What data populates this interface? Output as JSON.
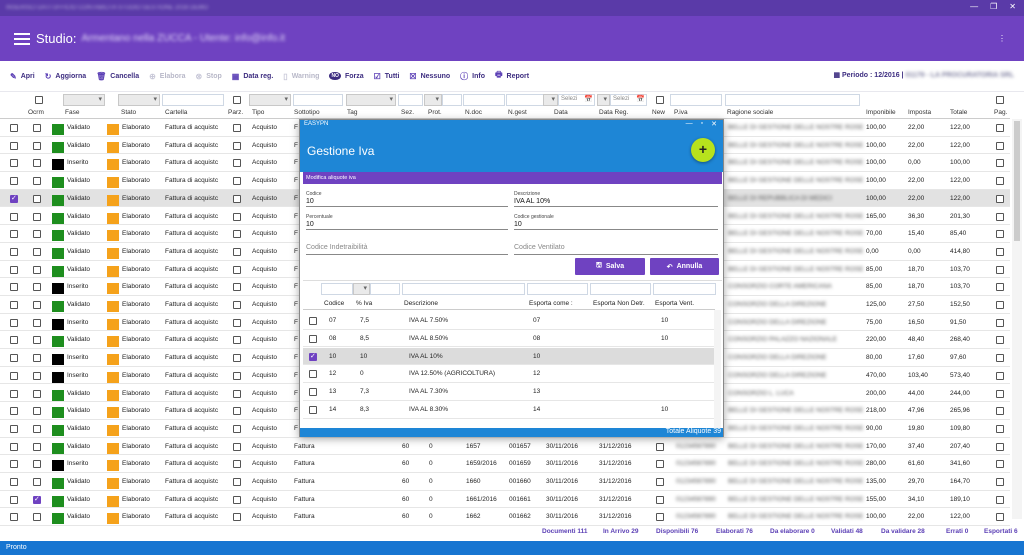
{
  "titlebar": {
    "text": "INSERISCI DATI UFFICIO CONTABILITA STUDIO GESTIONE 2016 DEMO",
    "btns": [
      "—",
      "❐",
      "✕"
    ]
  },
  "header": {
    "title": "Studio:",
    "subtitle": "Armentano nella ZUCCA - Utente: info@info.it",
    "menu_dots": "⋮"
  },
  "toolbar": {
    "items": [
      {
        "label": "Apri",
        "icon": "✎",
        "icon_name": "edit-icon",
        "disabled": false
      },
      {
        "label": "Aggiorna",
        "icon": "↻",
        "icon_name": "refresh-icon",
        "disabled": false
      },
      {
        "label": "Cancella",
        "icon": "🗑",
        "icon_name": "trash-icon",
        "disabled": false
      },
      {
        "label": "Elabora",
        "icon": "⊕",
        "icon_name": "process-icon",
        "disabled": true
      },
      {
        "label": "Stop",
        "icon": "⊗",
        "icon_name": "stop-icon",
        "disabled": true
      },
      {
        "label": "Data reg.",
        "icon": "▦",
        "icon_name": "calendar-icon",
        "disabled": false
      },
      {
        "label": "Warning",
        "icon": "▯",
        "icon_name": "warning-icon",
        "disabled": true
      },
      {
        "label": "Forza",
        "icon": "NO",
        "icon_name": "force-icon",
        "disabled": false
      },
      {
        "label": "Tutti",
        "icon": "☑",
        "icon_name": "select-all-icon",
        "disabled": false
      },
      {
        "label": "Nessuno",
        "icon": "☒",
        "icon_name": "select-none-icon",
        "disabled": false
      },
      {
        "label": "Info",
        "icon": "ⓘ",
        "icon_name": "info-icon",
        "disabled": false
      },
      {
        "label": "Report",
        "icon": "🖶",
        "icon_name": "report-icon",
        "disabled": false
      }
    ],
    "periodo": "Periodo : 12/2016 |",
    "periodo_extra": "01179 - LA PROCURATORIA SRL",
    "periodo_mid": ": 1179 -"
  },
  "filters": {
    "select_placeholder": "Selezi",
    "date_icon": "📅"
  },
  "columns": [
    "Ocrm",
    "Fase",
    "Stato",
    "Cartella",
    "Parz.",
    "Tipo",
    "Sottotipo",
    "Tag",
    "Sez.",
    "Prot.",
    "N.doc",
    "N.gest",
    "Data",
    "Data Reg.",
    "New",
    "P.iva",
    "Ragione sociale",
    "Imponibile",
    "Imposta",
    "Totale",
    "Pag."
  ],
  "rows": [
    {
      "ocrm": false,
      "fase": "Validato",
      "fc": "g",
      "stato": "Elaborato",
      "cartella": "Fattura di acquistc",
      "tipo": "Acquisto",
      "sott": "F",
      "sez": "",
      "prot": "",
      "ndoc": "",
      "ngest": "",
      "data": "",
      "dreg": "",
      "piva": "",
      "rag": "BELLE DI GESTIONE DELLE NOSTRE ROSE",
      "imp": "100,00",
      "iva": "22,00",
      "tot": "122,00",
      "sel": false,
      "selcb": false
    },
    {
      "ocrm": false,
      "fase": "Validato",
      "fc": "g",
      "stato": "Elaborato",
      "cartella": "Fattura di acquistc",
      "tipo": "Acquisto",
      "sott": "F",
      "sez": "",
      "prot": "",
      "ndoc": "",
      "ngest": "",
      "data": "",
      "dreg": "",
      "piva": "",
      "rag": "BELLE DI GESTIONE DELLE NOSTRE ROSE",
      "imp": "100,00",
      "iva": "22,00",
      "tot": "122,00",
      "sel": false,
      "selcb": false
    },
    {
      "ocrm": false,
      "fase": "Inserito",
      "fc": "b",
      "stato": "Elaborato",
      "cartella": "Fattura di acquistc",
      "tipo": "Acquisto",
      "sott": "F",
      "sez": "",
      "prot": "",
      "ndoc": "",
      "ngest": "",
      "data": "",
      "dreg": "",
      "piva": "",
      "rag": "BELLE DI GESTIONE DELLE NOSTRE ROSE",
      "imp": "100,00",
      "iva": "0,00",
      "tot": "100,00",
      "sel": false,
      "selcb": false
    },
    {
      "ocrm": false,
      "fase": "Validato",
      "fc": "g",
      "stato": "Elaborato",
      "cartella": "Fattura di acquistc",
      "tipo": "Acquisto",
      "sott": "F",
      "sez": "",
      "prot": "",
      "ndoc": "",
      "ngest": "",
      "data": "",
      "dreg": "",
      "piva": "",
      "rag": "BELLE DI GESTIONE DELLE NOSTRE ROSE",
      "imp": "100,00",
      "iva": "22,00",
      "tot": "122,00",
      "sel": false,
      "selcb": false
    },
    {
      "ocrm": false,
      "fase": "Validato",
      "fc": "g",
      "stato": "Elaborato",
      "cartella": "Fattura di acquistc",
      "tipo": "Acquisto",
      "sott": "F",
      "sez": "",
      "prot": "",
      "ndoc": "",
      "ngest": "",
      "data": "",
      "dreg": "",
      "piva": "",
      "rag": "BELLE DI REPUBBLICA DI MEDICI",
      "imp": "100,00",
      "iva": "22,00",
      "tot": "122,00",
      "sel": true,
      "selcb": true
    },
    {
      "ocrm": false,
      "fase": "Validato",
      "fc": "g",
      "stato": "Elaborato",
      "cartella": "Fattura di acquistc",
      "tipo": "Acquisto",
      "sott": "F",
      "sez": "",
      "prot": "",
      "ndoc": "",
      "ngest": "",
      "data": "",
      "dreg": "",
      "piva": "",
      "rag": "BELLE DI GESTIONE DELLE NOSTRE ROSE",
      "imp": "165,00",
      "iva": "36,30",
      "tot": "201,30",
      "sel": false,
      "selcb": false
    },
    {
      "ocrm": false,
      "fase": "Validato",
      "fc": "g",
      "stato": "Elaborato",
      "cartella": "Fattura di acquistc",
      "tipo": "Acquisto",
      "sott": "F",
      "sez": "",
      "prot": "",
      "ndoc": "",
      "ngest": "",
      "data": "",
      "dreg": "",
      "piva": "",
      "rag": "BELLE DI GESTIONE DELLE NOSTRE ROSE",
      "imp": "70,00",
      "iva": "15,40",
      "tot": "85,40",
      "sel": false,
      "selcb": false
    },
    {
      "ocrm": false,
      "fase": "Validato",
      "fc": "g",
      "stato": "Elaborato",
      "cartella": "Fattura di acquistc",
      "tipo": "Acquisto",
      "sott": "F",
      "sez": "",
      "prot": "",
      "ndoc": "",
      "ngest": "",
      "data": "",
      "dreg": "",
      "piva": "",
      "rag": "BELLE DI GESTIONE DELLE NOSTRE ROSE",
      "imp": "0,00",
      "iva": "0,00",
      "tot": "414,80",
      "sel": false,
      "selcb": false
    },
    {
      "ocrm": false,
      "fase": "Validato",
      "fc": "g",
      "stato": "Elaborato",
      "cartella": "Fattura di acquistc",
      "tipo": "Acquisto",
      "sott": "F",
      "sez": "",
      "prot": "",
      "ndoc": "",
      "ngest": "",
      "data": "",
      "dreg": "",
      "piva": "",
      "rag": "BELLE DI GESTIONE DELLE NOSTRE ROSE",
      "imp": "85,00",
      "iva": "18,70",
      "tot": "103,70",
      "sel": false,
      "selcb": false
    },
    {
      "ocrm": false,
      "fase": "Inserito",
      "fc": "b",
      "stato": "Elaborato",
      "cartella": "Fattura di acquistc",
      "tipo": "Acquisto",
      "sott": "F",
      "sez": "",
      "prot": "",
      "ndoc": "",
      "ngest": "",
      "data": "",
      "dreg": "",
      "piva": "",
      "rag": "CONSORZIO CORTE AMERICANA",
      "imp": "85,00",
      "iva": "18,70",
      "tot": "103,70",
      "sel": false,
      "selcb": false
    },
    {
      "ocrm": false,
      "fase": "Validato",
      "fc": "g",
      "stato": "Elaborato",
      "cartella": "Fattura di acquistc",
      "tipo": "Acquisto",
      "sott": "F",
      "sez": "",
      "prot": "",
      "ndoc": "",
      "ngest": "",
      "data": "",
      "dreg": "",
      "piva": "",
      "rag": "CONSORZIO DELLA DIREZIONE",
      "imp": "125,00",
      "iva": "27,50",
      "tot": "152,50",
      "sel": false,
      "selcb": false
    },
    {
      "ocrm": false,
      "fase": "Inserito",
      "fc": "b",
      "stato": "Elaborato",
      "cartella": "Fattura di acquistc",
      "tipo": "Acquisto",
      "sott": "F",
      "sez": "",
      "prot": "",
      "ndoc": "",
      "ngest": "",
      "data": "",
      "dreg": "",
      "piva": "",
      "rag": "CONSORZIO DELLA DIREZIONE",
      "imp": "75,00",
      "iva": "16,50",
      "tot": "91,50",
      "sel": false,
      "selcb": false
    },
    {
      "ocrm": false,
      "fase": "Validato",
      "fc": "g",
      "stato": "Elaborato",
      "cartella": "Fattura di acquistc",
      "tipo": "Acquisto",
      "sott": "F",
      "sez": "",
      "prot": "",
      "ndoc": "",
      "ngest": "",
      "data": "",
      "dreg": "",
      "piva": "",
      "rag": "CONSORZIO PALAZZO NAZIONALE",
      "imp": "220,00",
      "iva": "48,40",
      "tot": "268,40",
      "sel": false,
      "selcb": false
    },
    {
      "ocrm": false,
      "fase": "Inserito",
      "fc": "b",
      "stato": "Elaborato",
      "cartella": "Fattura di acquistc",
      "tipo": "Acquisto",
      "sott": "F",
      "sez": "",
      "prot": "",
      "ndoc": "",
      "ngest": "",
      "data": "",
      "dreg": "",
      "piva": "",
      "rag": "CONSORZIO DELLA DIREZIONE",
      "imp": "80,00",
      "iva": "17,60",
      "tot": "97,60",
      "sel": false,
      "selcb": false
    },
    {
      "ocrm": false,
      "fase": "Inserito",
      "fc": "b",
      "stato": "Elaborato",
      "cartella": "Fattura di acquistc",
      "tipo": "Acquisto",
      "sott": "F",
      "sez": "",
      "prot": "",
      "ndoc": "",
      "ngest": "",
      "data": "",
      "dreg": "",
      "piva": "",
      "rag": "CONSORZIO DELLA DIREZIONE",
      "imp": "470,00",
      "iva": "103,40",
      "tot": "573,40",
      "sel": false,
      "selcb": false
    },
    {
      "ocrm": false,
      "fase": "Validato",
      "fc": "g",
      "stato": "Elaborato",
      "cartella": "Fattura di acquistc",
      "tipo": "Acquisto",
      "sott": "F",
      "sez": "",
      "prot": "",
      "ndoc": "",
      "ngest": "",
      "data": "",
      "dreg": "",
      "piva": "",
      "rag": "CONSORZIO L. LUCA",
      "imp": "200,00",
      "iva": "44,00",
      "tot": "244,00",
      "sel": false,
      "selcb": false
    },
    {
      "ocrm": false,
      "fase": "Validato",
      "fc": "g",
      "stato": "Elaborato",
      "cartella": "Fattura di acquistc",
      "tipo": "Acquisto",
      "sott": "F",
      "sez": "",
      "prot": "",
      "ndoc": "",
      "ngest": "",
      "data": "",
      "dreg": "",
      "piva": "",
      "rag": "BELLE DI GESTIONE DELLE NOSTRE ROSE",
      "imp": "218,00",
      "iva": "47,96",
      "tot": "265,96",
      "sel": false,
      "selcb": false
    },
    {
      "ocrm": false,
      "fase": "Validato",
      "fc": "g",
      "stato": "Elaborato",
      "cartella": "Fattura di acquistc",
      "tipo": "Acquisto",
      "sott": "F",
      "sez": "",
      "prot": "",
      "ndoc": "",
      "ngest": "",
      "data": "",
      "dreg": "",
      "piva": "",
      "rag": "BELLE DI GESTIONE DELLE NOSTRE ROSE",
      "imp": "90,00",
      "iva": "19,80",
      "tot": "109,80",
      "sel": false,
      "selcb": false
    },
    {
      "ocrm": false,
      "fase": "Validato",
      "fc": "g",
      "stato": "Elaborato",
      "cartella": "Fattura di acquistc",
      "tipo": "Acquisto",
      "sott": "Fattura",
      "sez": "60",
      "prot": "0",
      "ndoc": "1657",
      "ngest": "001657",
      "data": "30/11/2016",
      "dreg": "31/12/2016",
      "piva": "01234567890",
      "rag": "BELLE DI GESTIONE DELLE NOSTRE ROSE",
      "imp": "170,00",
      "iva": "37,40",
      "tot": "207,40",
      "sel": false,
      "selcb": false
    },
    {
      "ocrm": false,
      "fase": "Inserito",
      "fc": "b",
      "stato": "Elaborato",
      "cartella": "Fattura di acquistc",
      "tipo": "Acquisto",
      "sott": "Fattura",
      "sez": "60",
      "prot": "0",
      "ndoc": "1659/2016",
      "ngest": "001659",
      "data": "30/11/2016",
      "dreg": "31/12/2016",
      "piva": "01234567890",
      "rag": "BELLE DI GESTIONE DELLE NOSTRE ROSE",
      "imp": "280,00",
      "iva": "61,60",
      "tot": "341,60",
      "sel": false,
      "selcb": false
    },
    {
      "ocrm": false,
      "fase": "Validato",
      "fc": "g",
      "stato": "Elaborato",
      "cartella": "Fattura di acquistc",
      "tipo": "Acquisto",
      "sott": "Fattura",
      "sez": "60",
      "prot": "0",
      "ndoc": "1660",
      "ngest": "001660",
      "data": "30/11/2016",
      "dreg": "31/12/2016",
      "piva": "01234567890",
      "rag": "BELLE DI GESTIONE DELLE NOSTRE ROSE",
      "imp": "135,00",
      "iva": "29,70",
      "tot": "164,70",
      "sel": false,
      "selcb": false
    },
    {
      "ocrm": true,
      "fase": "Validato",
      "fc": "g",
      "stato": "Elaborato",
      "cartella": "Fattura di acquistc",
      "tipo": "Acquisto",
      "sott": "Fattura",
      "sez": "60",
      "prot": "0",
      "ndoc": "1661/2016",
      "ngest": "001661",
      "data": "30/11/2016",
      "dreg": "31/12/2016",
      "piva": "01234567890",
      "rag": "BELLE DI GESTIONE DELLE NOSTRE ROSE",
      "imp": "155,00",
      "iva": "34,10",
      "tot": "189,10",
      "sel": false,
      "selcb": false
    },
    {
      "ocrm": false,
      "fase": "Validato",
      "fc": "g",
      "stato": "Elaborato",
      "cartella": "Fattura di acquistc",
      "tipo": "Acquisto",
      "sott": "Fattura",
      "sez": "60",
      "prot": "0",
      "ndoc": "1662",
      "ngest": "001662",
      "data": "30/11/2016",
      "dreg": "31/12/2016",
      "piva": "01234567890",
      "rag": "BELLE DI GESTIONE DELLE NOSTRE ROSE",
      "imp": "100,00",
      "iva": "22,00",
      "tot": "122,00",
      "sel": false,
      "selcb": false
    }
  ],
  "footer": [
    "Documenti 111",
    "In Arrivo 29",
    "Disponibili 76",
    "Elaborati 76",
    "Da elaborare 0",
    "Validati 48",
    "Da validare 28",
    "Errati 0",
    "Esportati 6"
  ],
  "status": "Pronto",
  "dialog": {
    "window_title": "EASYPN",
    "title": "Gestione Iva",
    "add": "+",
    "section": "Modifica aliquote iva",
    "codice_label": "Codice",
    "codice_value": "10",
    "descr_label": "Descrizione",
    "descr_value": "IVA AL 10%",
    "perc_label": "Percentuale",
    "perc_value": "10",
    "codgest_label": "Codice gestionale",
    "codgest_value": "10",
    "indetr_placeholder": "Codice Indetraibilità",
    "ventil_placeholder": "Codice Ventilato",
    "salva": "Salva",
    "annulla": "Annulla",
    "columns": [
      "Codice",
      "% Iva",
      "Descrizione",
      "Esporta come :",
      "Esporta Non Detr.",
      "Esporta Vent."
    ],
    "rows": [
      {
        "cod": "07",
        "iva": "7,5",
        "desc": "IVA AL 7.50%",
        "esp": "07",
        "nd": "",
        "vent": "10",
        "sel": false
      },
      {
        "cod": "08",
        "iva": "8,5",
        "desc": "IVA AL 8.50%",
        "esp": "08",
        "nd": "",
        "vent": "10",
        "sel": false
      },
      {
        "cod": "10",
        "iva": "10",
        "desc": "IVA AL 10%",
        "esp": "10",
        "nd": "",
        "vent": "",
        "sel": true
      },
      {
        "cod": "12",
        "iva": "0",
        "desc": "IVA 12.50% (AGRICOLTURA)",
        "esp": "12",
        "nd": "",
        "vent": "",
        "sel": false
      },
      {
        "cod": "13",
        "iva": "7,3",
        "desc": "IVA AL 7.30%",
        "esp": "13",
        "nd": "",
        "vent": "",
        "sel": false
      },
      {
        "cod": "14",
        "iva": "8,3",
        "desc": "IVA AL 8.30%",
        "esp": "14",
        "nd": "",
        "vent": "10",
        "sel": false
      }
    ],
    "total": "Totale Aliquote 39"
  }
}
